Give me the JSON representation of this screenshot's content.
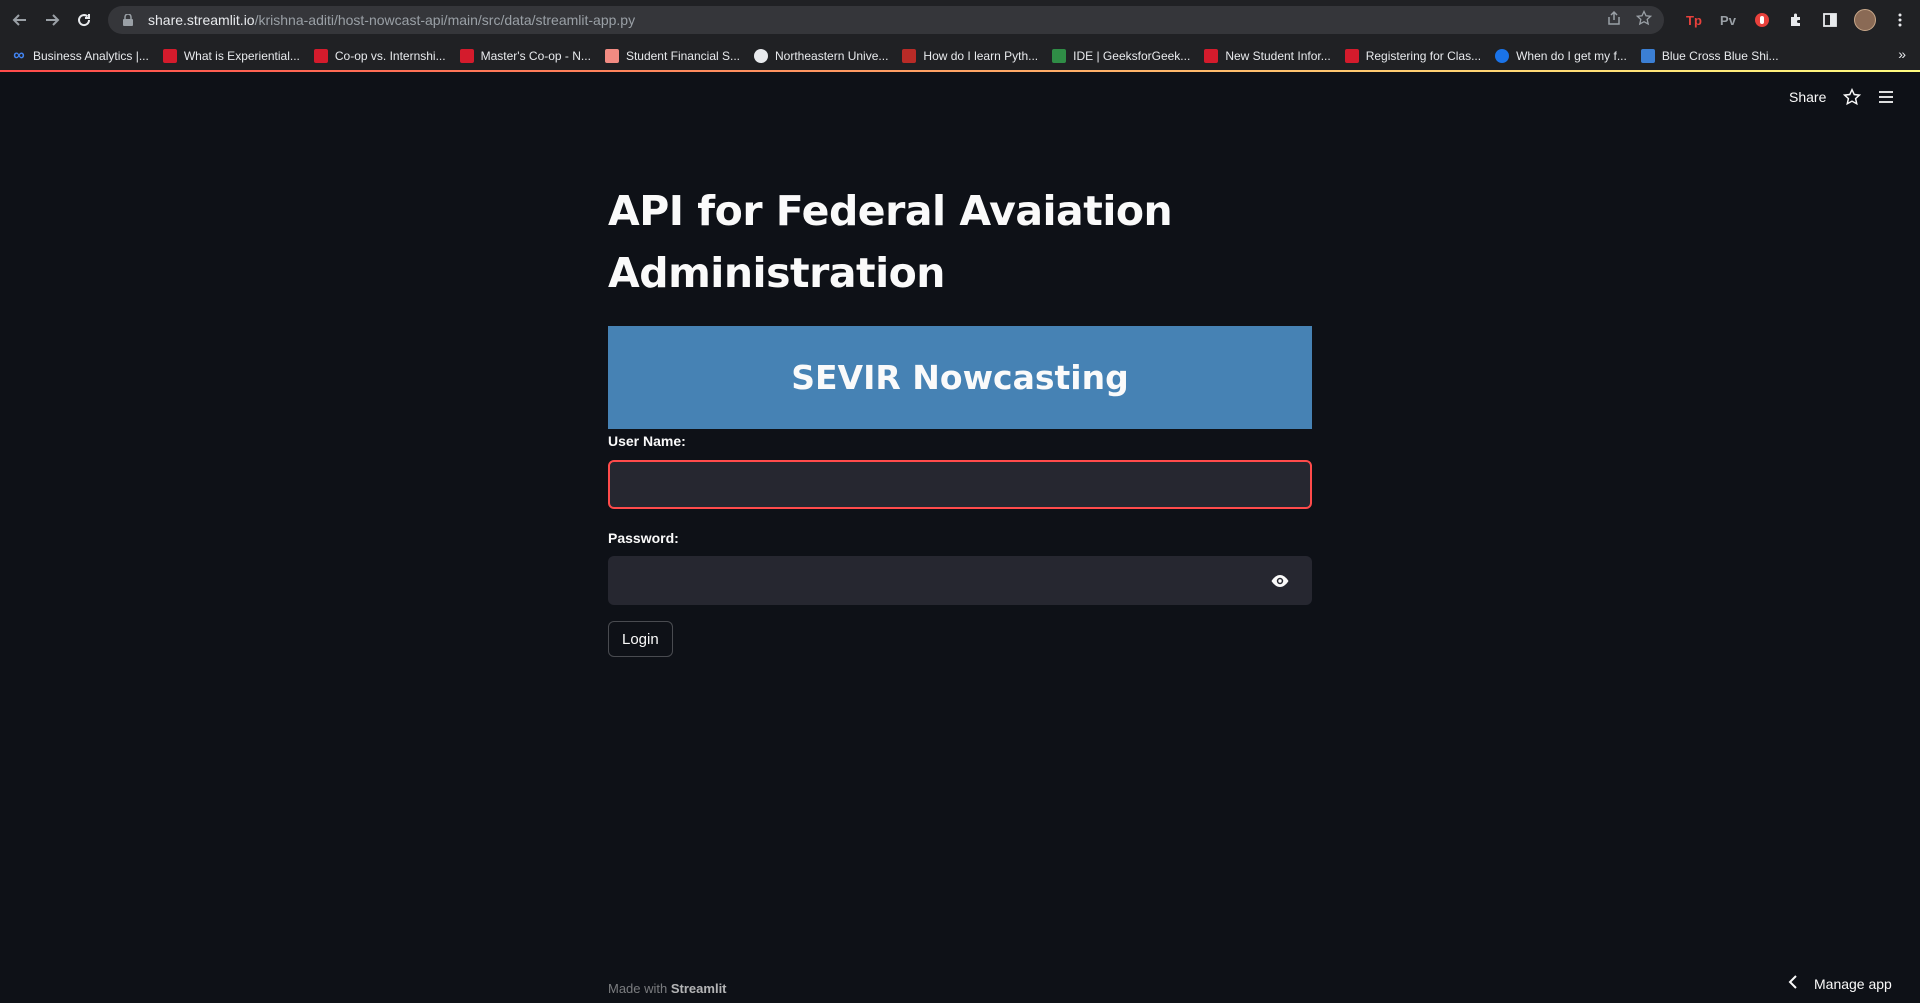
{
  "browser": {
    "url_host": "share.streamlit.io",
    "url_path": "/krishna-aditi/host-nowcast-api/main/src/data/streamlit-app.py",
    "bookmarks": [
      {
        "label": "Business Analytics |...",
        "icon": "infinity-icon",
        "color": "#4285f4"
      },
      {
        "label": "What is Experiential...",
        "icon": "northeastern-icon",
        "color": "#d41b2c"
      },
      {
        "label": "Co-op vs. Internshi...",
        "icon": "northeastern-icon",
        "color": "#d41b2c"
      },
      {
        "label": "Master's Co-op - N...",
        "icon": "northeastern-icon",
        "color": "#d41b2c"
      },
      {
        "label": "Student Financial S...",
        "icon": "flower-icon",
        "color": "#f28b82"
      },
      {
        "label": "Northeastern Unive...",
        "icon": "globe-icon",
        "color": "#e8eaed"
      },
      {
        "label": "How do I learn Pyth...",
        "icon": "quora-icon",
        "color": "#b92b27"
      },
      {
        "label": "IDE | GeeksforGeek...",
        "icon": "gfg-icon",
        "color": "#2f8d46"
      },
      {
        "label": "New Student Infor...",
        "icon": "northeastern-icon",
        "color": "#d41b2c"
      },
      {
        "label": "Registering for Clas...",
        "icon": "n-icon",
        "color": "#d41b2c"
      },
      {
        "label": "When do I get my f...",
        "icon": "globe-icon",
        "color": "#1a73e8"
      },
      {
        "label": "Blue Cross Blue Shi...",
        "icon": "bcbs-icon",
        "color": "#3b7fd4"
      }
    ],
    "extensions": [
      "Tp",
      "Pv"
    ]
  },
  "header": {
    "share_label": "Share"
  },
  "main": {
    "title": "API for Federal Avaiation Administration",
    "banner_text": "SEVIR Nowcasting",
    "username_label": "User Name:",
    "username_value": "",
    "password_label": "Password:",
    "password_value": "",
    "login_label": "Login"
  },
  "footer": {
    "made_with": "Made with ",
    "brand": "Streamlit",
    "manage_label": "Manage app"
  },
  "colors": {
    "background": "#0e1117",
    "banner": "#4682b4",
    "input_bg": "#262730",
    "focus": "#ff4b4b"
  }
}
